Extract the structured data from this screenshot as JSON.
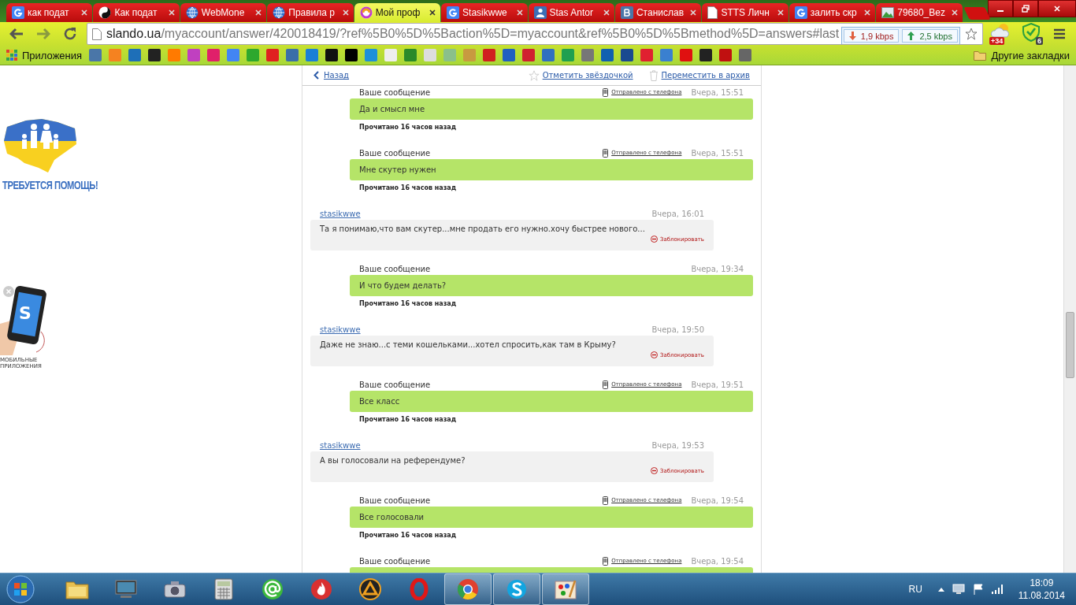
{
  "tabs": [
    {
      "title": "как подат",
      "kind": "google",
      "selected": false
    },
    {
      "title": "Как подат",
      "kind": "yinyang",
      "selected": false
    },
    {
      "title": "WebMone",
      "kind": "globe",
      "selected": false
    },
    {
      "title": "Правила р",
      "kind": "globe",
      "selected": false
    },
    {
      "title": "Мой проф",
      "kind": "swirl",
      "selected": true
    },
    {
      "title": "Stasikwwe",
      "kind": "google",
      "selected": false
    },
    {
      "title": "Stas Antor",
      "kind": "person",
      "selected": false
    },
    {
      "title": "Станислав",
      "kind": "vk",
      "selected": false
    },
    {
      "title": "STTS Личн",
      "kind": "doc",
      "selected": false
    },
    {
      "title": "залить скр",
      "kind": "google",
      "selected": false
    },
    {
      "title": "79680_Bez",
      "kind": "image",
      "selected": false
    }
  ],
  "toolbar": {
    "url_host": "slando.ua",
    "url_path": "/myaccount/answer/420018419/?ref%5B0%5D%5Baction%5D=myaccount&ref%5B0%5D%5Bmethod%5D=answers#last",
    "download": "1,9 kbps",
    "upload": "2,5 kbps",
    "weather_badge": "+34",
    "shield_badge": "6"
  },
  "bookmarks": {
    "apps_label": "Приложения",
    "items": [
      {
        "color": "#4a76a8"
      },
      {
        "color": "#f58220"
      },
      {
        "color": "#1e6fb8"
      },
      {
        "color": "#222222"
      },
      {
        "color": "#ff7a00"
      },
      {
        "color": "#c040c0"
      },
      {
        "color": "#e0206a"
      },
      {
        "color": "#4285f4"
      },
      {
        "color": "#2ea82e"
      },
      {
        "color": "#e02020"
      },
      {
        "color": "#3a6fa8"
      },
      {
        "color": "#1a7fd8"
      },
      {
        "color": "#111111"
      },
      {
        "color": "#000000"
      },
      {
        "color": "#1e90d8"
      },
      {
        "color": "#eeeeee"
      },
      {
        "color": "#2a8a2a"
      },
      {
        "color": "#dddddd"
      },
      {
        "color": "#8ac08a"
      },
      {
        "color": "#c89a40"
      },
      {
        "color": "#d02020"
      },
      {
        "color": "#2060c0"
      },
      {
        "color": "#d02030"
      },
      {
        "color": "#3070c0"
      },
      {
        "color": "#20a050"
      },
      {
        "color": "#777777"
      },
      {
        "color": "#1060b0"
      },
      {
        "color": "#1a4a90"
      },
      {
        "color": "#e02030"
      },
      {
        "color": "#3a80d0"
      },
      {
        "color": "#e01010"
      },
      {
        "color": "#222222"
      },
      {
        "color": "#c01010"
      },
      {
        "color": "#666666"
      }
    ],
    "other_label": "Другие закладки"
  },
  "ads": [
    {
      "kind": "map",
      "caption": "ТРЕБУЕТСЯ ПОМОЩЬ!"
    },
    {
      "kind": "phone",
      "glyph": "S",
      "caption": "МОБИЛЬНЫЕ ПРИЛОЖЕНИЯ"
    }
  ],
  "thread": {
    "back": "Назад",
    "star": "Отметить звёздочкой",
    "archive": "Переместить в архив",
    "messages": [
      {
        "kind": "own",
        "sender": "Ваше сообщение",
        "note": "Отправлено с телефона",
        "time": "Вчера, 15:51",
        "text": "Да и смысл мне",
        "read": "Прочитано 16 часов назад"
      },
      {
        "kind": "own",
        "sender": "Ваше сообщение",
        "note": "Отправлено с телефона",
        "time": "Вчера, 15:51",
        "text": "Мне скутер нужен",
        "read": "Прочитано 16 часов назад"
      },
      {
        "kind": "incoming",
        "author": "stasikwwe",
        "time": "Вчера, 16:01",
        "text": "Та я понимаю,что вам скутер...мне продать его нужно.хочу быстрее нового...",
        "block": "Заблокировать"
      },
      {
        "kind": "own",
        "sender": "Ваше сообщение",
        "time": "Вчера, 19:34",
        "text": "И что будем делать?",
        "read": "Прочитано 16 часов назад"
      },
      {
        "kind": "incoming",
        "author": "stasikwwe",
        "time": "Вчера, 19:50",
        "text": "Даже не знаю...с теми кошельками...хотел спросить,как там в Крыму?",
        "block": "Заблокировать"
      },
      {
        "kind": "own",
        "sender": "Ваше сообщение",
        "note": "Отправлено с телефона",
        "time": "Вчера, 19:51",
        "text": "Все класс",
        "read": "Прочитано 16 часов назад"
      },
      {
        "kind": "incoming",
        "author": "stasikwwe",
        "time": "Вчера, 19:53",
        "text": "А вы голосовали на референдуме?",
        "block": "Заблокировать"
      },
      {
        "kind": "own",
        "sender": "Ваше сообщение",
        "note": "Отправлено с телефона",
        "time": "Вчера, 19:54",
        "text": "Все голосовали",
        "read": "Прочитано 16 часов назад"
      },
      {
        "kind": "own",
        "sender": "Ваше сообщение",
        "note": "Отправлено с телефона",
        "time": "Вчера, 19:54"
      }
    ]
  },
  "taskbar": {
    "apps": [
      {
        "kind": "folder",
        "active": false
      },
      {
        "kind": "monitor",
        "active": false
      },
      {
        "kind": "camera",
        "active": false
      },
      {
        "kind": "calculator",
        "active": false
      },
      {
        "kind": "at",
        "active": false
      },
      {
        "kind": "flame",
        "active": false
      },
      {
        "kind": "triangle",
        "active": false
      },
      {
        "kind": "ring",
        "active": false
      },
      {
        "kind": "chrome",
        "active": true
      },
      {
        "kind": "skype",
        "active": true
      },
      {
        "kind": "paint",
        "active": true
      }
    ],
    "language": "RU",
    "time": "18:09",
    "date": "11.08.2014"
  }
}
